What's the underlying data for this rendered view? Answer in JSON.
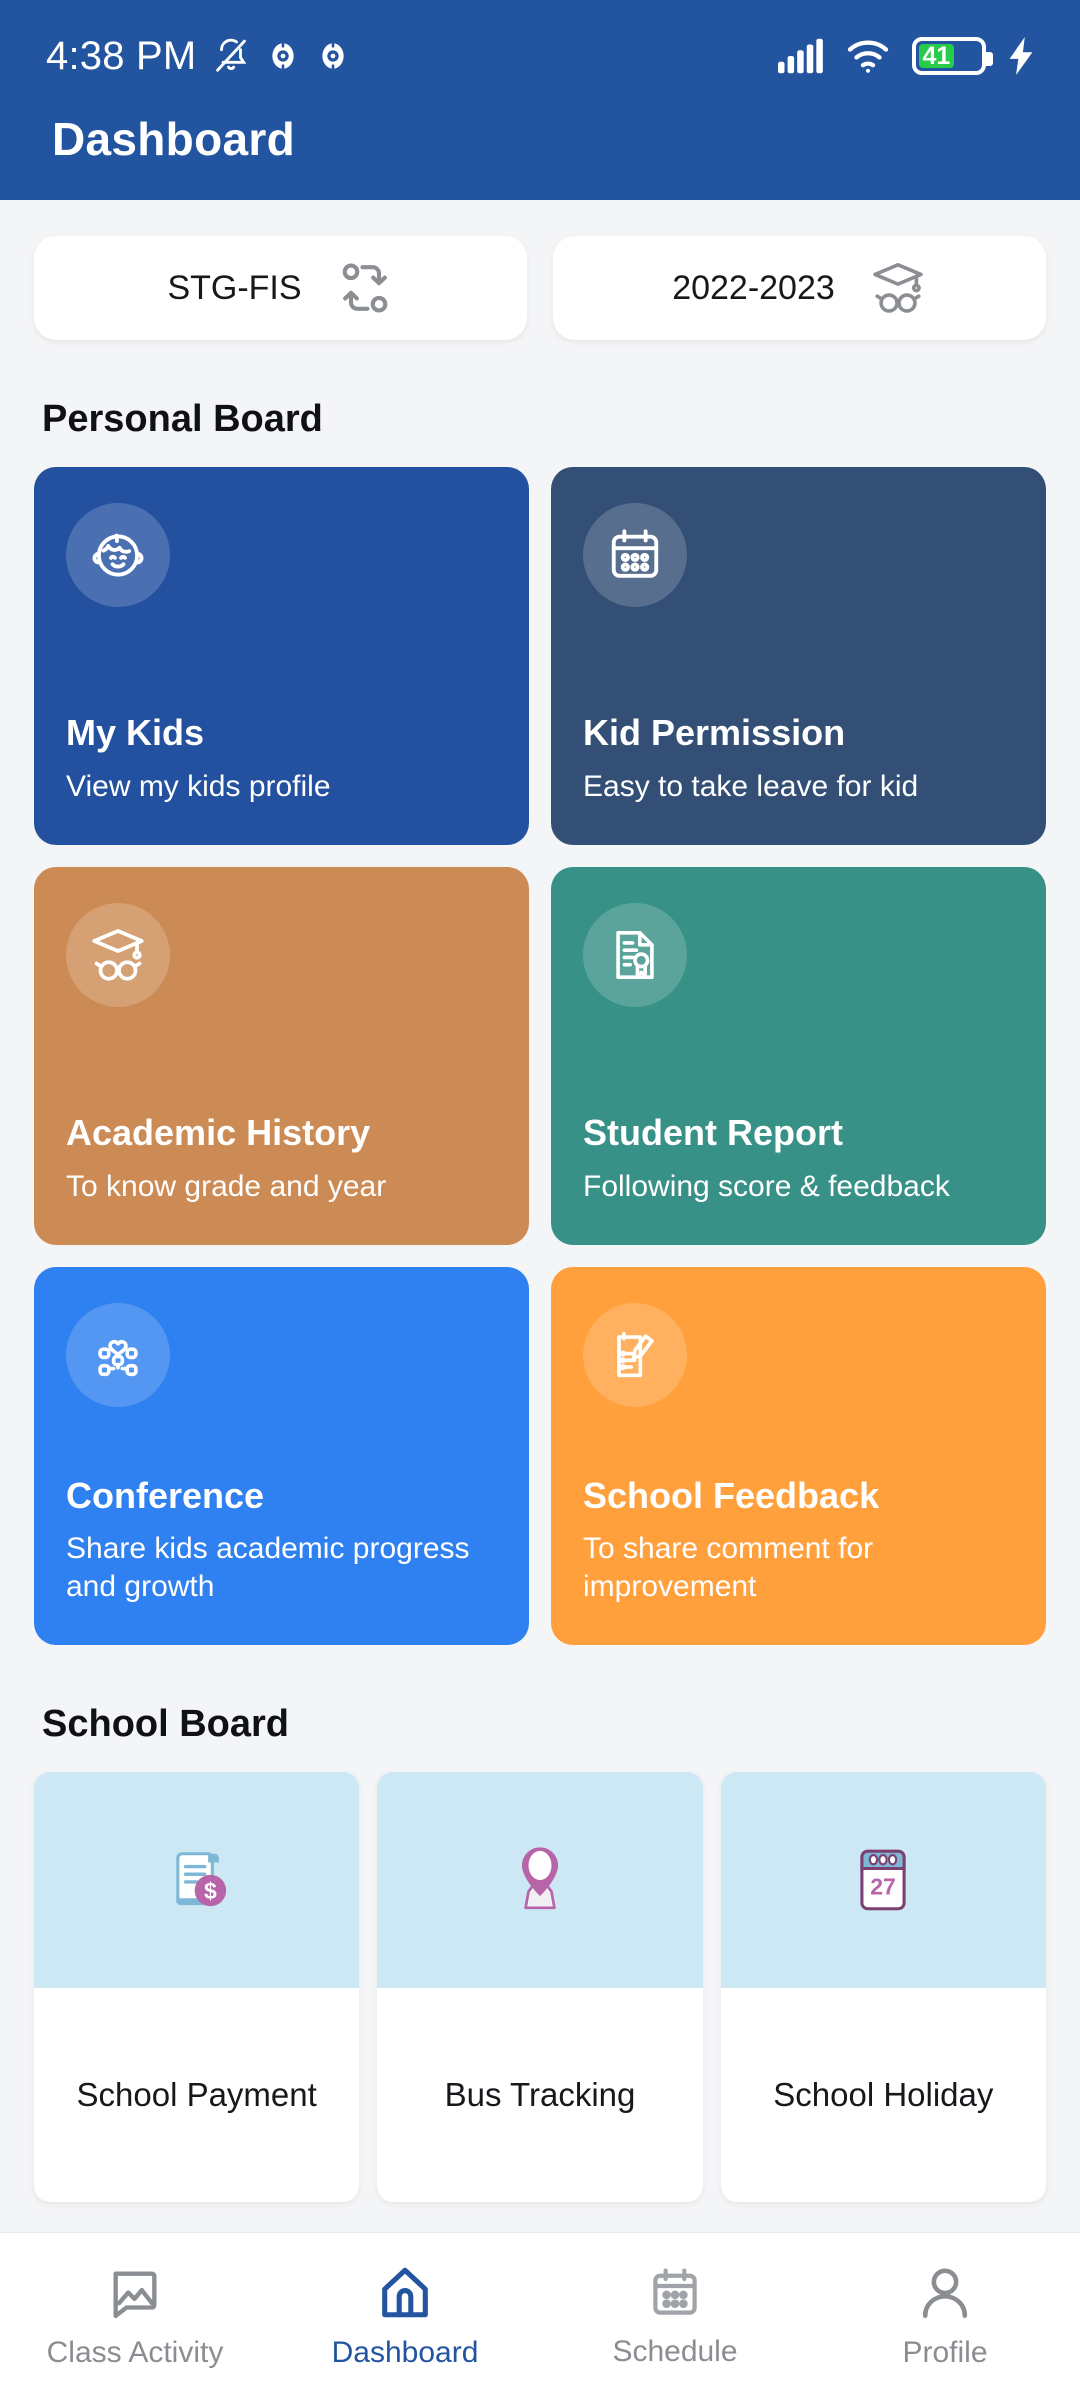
{
  "status_bar": {
    "time": "4:38 PM",
    "battery_percent": "41",
    "icons": [
      "bell-muted-icon",
      "app-badge-icon",
      "app-badge-icon",
      "cellular-signal-icon",
      "wifi-icon",
      "battery-icon",
      "charging-bolt-icon"
    ]
  },
  "app_bar": {
    "title": "Dashboard"
  },
  "selectors": [
    {
      "label": "STG-FIS",
      "icon": "swap-arrows-icon"
    },
    {
      "label": "2022-2023",
      "icon": "graduation-glasses-icon"
    }
  ],
  "personal_board": {
    "title": "Personal Board",
    "cards": [
      {
        "title": "My Kids",
        "subtitle": "View my kids profile",
        "icon": "child-face-icon",
        "color": "#2351a0"
      },
      {
        "title": "Kid Permission",
        "subtitle": "Easy to take leave for kid",
        "icon": "calendar-dots-icon",
        "color": "#334f76"
      },
      {
        "title": "Academic History",
        "subtitle": "To know grade and year",
        "icon": "graduation-glasses-icon",
        "color": "#cc8b55"
      },
      {
        "title": "Student Report",
        "subtitle": "Following score & feedback",
        "icon": "certificate-document-icon",
        "color": "#389186"
      },
      {
        "title": "Conference",
        "subtitle": "Share kids academic progress and growth",
        "icon": "group-heart-icon",
        "color": "#2f80f0"
      },
      {
        "title": "School Feedback",
        "subtitle": "To share comment for improvement",
        "icon": "clipboard-pencil-icon",
        "color": "#ffa03c"
      }
    ]
  },
  "school_board": {
    "title": "School Board",
    "cards": [
      {
        "label": "School Payment",
        "icon": "invoice-dollar-icon"
      },
      {
        "label": "Bus Tracking",
        "icon": "map-pin-icon"
      },
      {
        "label": "School Holiday",
        "icon": "calendar-27-icon",
        "day": "27"
      }
    ]
  },
  "bottom_nav": {
    "items": [
      {
        "label": "Class Activity",
        "icon": "image-photo-icon",
        "active": false
      },
      {
        "label": "Dashboard",
        "icon": "home-icon",
        "active": true
      },
      {
        "label": "Schedule",
        "icon": "calendar-icon",
        "active": false
      },
      {
        "label": "Profile",
        "icon": "person-icon",
        "active": false
      }
    ]
  },
  "colors": {
    "brand": "#23549f",
    "page_background": "#f4f5f7",
    "school_board_icon_bg": "#cde8f5",
    "battery_green": "#29cc4a"
  }
}
